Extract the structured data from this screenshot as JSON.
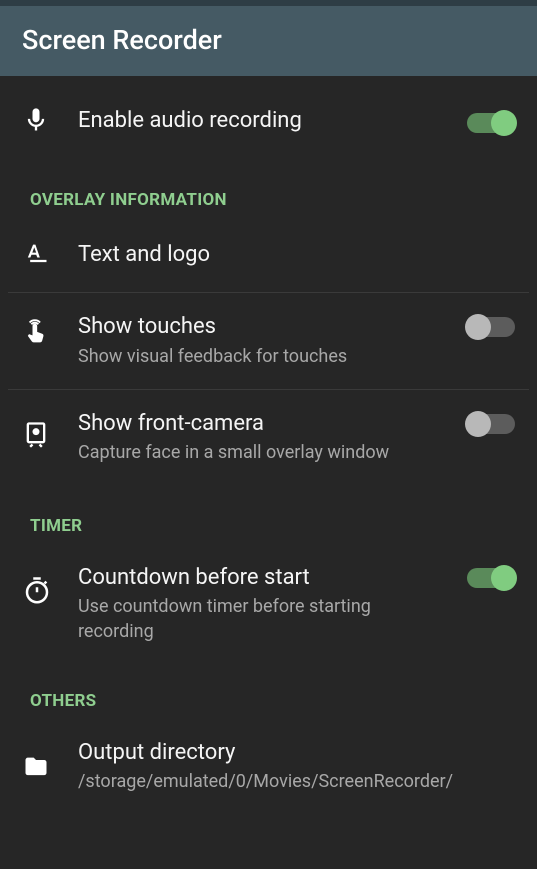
{
  "app_bar": {
    "title": "Screen Recorder"
  },
  "sections": {
    "overlay": {
      "header": "OVERLAY INFORMATION"
    },
    "timer": {
      "header": "TIMER"
    },
    "others": {
      "header": "OTHERS"
    }
  },
  "settings": {
    "audio": {
      "title": "Enable audio recording"
    },
    "text_logo": {
      "title": "Text and logo"
    },
    "touches": {
      "title": "Show touches",
      "subtitle": "Show visual feedback for touches"
    },
    "front_camera": {
      "title": "Show front-camera",
      "subtitle": "Capture face in a small overlay window"
    },
    "countdown": {
      "title": "Countdown before start",
      "subtitle": "Use countdown timer before starting recording"
    },
    "output_dir": {
      "title": "Output directory",
      "subtitle": "/storage/emulated/0/Movies/ScreenRecorder/"
    }
  },
  "toggles": {
    "audio": true,
    "touches": false,
    "front_camera": false,
    "countdown": true
  }
}
